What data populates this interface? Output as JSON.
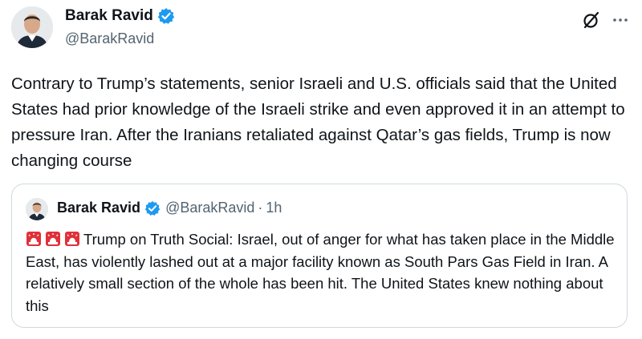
{
  "author": {
    "name": "Barak Ravid",
    "handle": "@BarakRavid",
    "verified": true
  },
  "post": {
    "text": "Contrary to Trump’s statements, senior Israeli and U.S. officials said that the United States had prior knowledge of the Israeli strike and even approved it in an attempt to pressure Iran. After the Iranians retaliated against Qatar’s gas fields, Trump is now changing course"
  },
  "header_icons": [
    "grok-icon",
    "more-icon"
  ],
  "quoted": {
    "name": "Barak Ravid",
    "handle": "@BarakRavid",
    "separator": "·",
    "time": "1h",
    "emoji": [
      "siren",
      "siren",
      "siren"
    ],
    "text": "Trump on Truth Social: Israel, out of anger for what has taken place in the Middle East, has violently lashed out at a major facility known as South Pars Gas Field in Iran. A relatively small section of the whole has been hit. The United States knew nothing about this"
  },
  "colors": {
    "text": "#0f1419",
    "secondary": "#536471",
    "verified_blue": "#1d9bf0",
    "border": "#cfd9de",
    "siren_red": "#e0313a"
  }
}
